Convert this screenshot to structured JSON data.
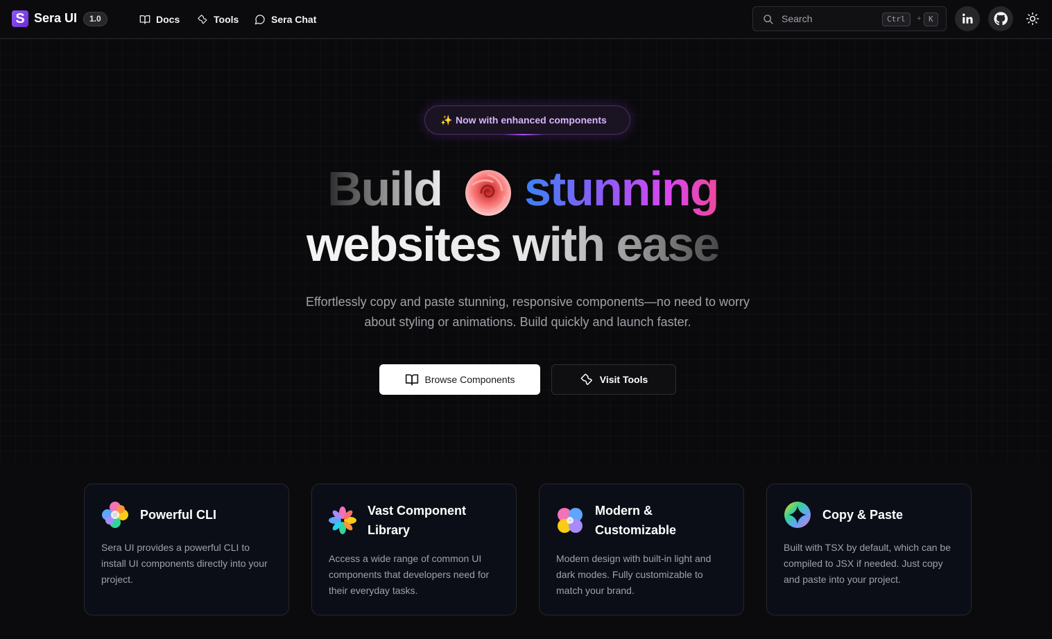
{
  "header": {
    "logo_letter": "S",
    "brand": "Sera UI",
    "version": "1.0",
    "nav": [
      {
        "label": "Docs",
        "icon": "book-icon"
      },
      {
        "label": "Tools",
        "icon": "wrench-icon"
      },
      {
        "label": "Sera Chat",
        "icon": "chat-bubble-icon"
      }
    ],
    "search": {
      "placeholder": "Search",
      "kbd1": "Ctrl",
      "kbd_plus": "+",
      "kbd2": "K"
    },
    "social": [
      "linkedin-icon",
      "github-icon"
    ],
    "theme_toggle_icon": "sun-icon"
  },
  "hero": {
    "badge_star": "✨",
    "badge": "Now with enhanced components",
    "title_word1": "Build",
    "title_word2": "stunning",
    "title_line2": "websites with ease",
    "subtitle": "Effortlessly copy and paste stunning, responsive components—no need to worry about styling or animations. Build quickly and launch faster.",
    "primary_button": "Browse Components",
    "secondary_button": "Visit Tools"
  },
  "features": [
    {
      "title": "Powerful CLI",
      "desc": "Sera UI provides a powerful CLI to install UI components directly into your project.",
      "icon": "rainbow-flower-icon"
    },
    {
      "title": "Vast Component Library",
      "desc": "Access a wide range of common UI components that developers need for their everyday tasks.",
      "icon": "rainbow-pinwheel-icon"
    },
    {
      "title": "Modern & Customizable",
      "desc": "Modern design with built-in light and dark modes. Fully customizable to match your brand.",
      "icon": "rainbow-clover-icon"
    },
    {
      "title": "Copy & Paste",
      "desc": "Built with TSX by default, which can be compiled to JSX if needed. Just copy and paste into your project.",
      "icon": "rainbow-sparkle-icon"
    }
  ],
  "colors": {
    "accent": "#8b5cf6",
    "background": "#0a0a0c",
    "card": "#0b0e17"
  }
}
